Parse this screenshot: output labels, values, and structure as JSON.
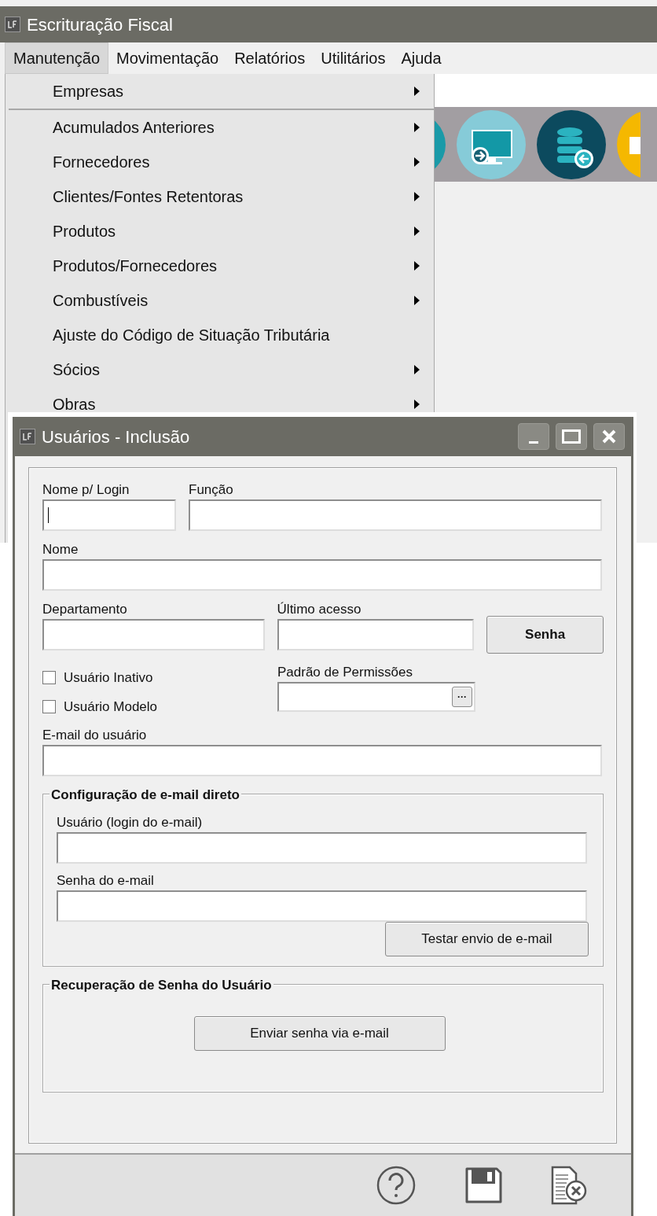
{
  "app": {
    "title": "Escrituração Fiscal"
  },
  "menubar": [
    {
      "label": "Manutenção",
      "selected": true
    },
    {
      "label": "Movimentação",
      "selected": false
    },
    {
      "label": "Relatórios",
      "selected": false
    },
    {
      "label": "Utilitários",
      "selected": false
    },
    {
      "label": "Ajuda",
      "selected": false
    }
  ],
  "menu": [
    {
      "label": "Empresas",
      "has_submenu": true,
      "separator_after": true
    },
    {
      "label": "Acumulados Anteriores",
      "has_submenu": true,
      "separator_after": false
    },
    {
      "label": "Fornecedores",
      "has_submenu": true,
      "separator_after": false
    },
    {
      "label": "Clientes/Fontes Retentoras",
      "has_submenu": true,
      "separator_after": false
    },
    {
      "label": "Produtos",
      "has_submenu": true,
      "separator_after": false
    },
    {
      "label": "Produtos/Fornecedores",
      "has_submenu": true,
      "separator_after": false
    },
    {
      "label": "Combustíveis",
      "has_submenu": true,
      "separator_after": false
    },
    {
      "label": "Ajuste do Código de Situação Tributária",
      "has_submenu": false,
      "separator_after": false
    },
    {
      "label": "Sócios",
      "has_submenu": true,
      "separator_after": false
    },
    {
      "label": "Obras",
      "has_submenu": true,
      "separator_after": false
    }
  ],
  "dialog": {
    "title": "Usuários - Inclusão",
    "login": {
      "label": "Nome p/ Login",
      "focused": true
    },
    "funcao": {
      "label": "Função"
    },
    "nome": {
      "label": "Nome"
    },
    "departamento": {
      "label": "Departamento"
    },
    "ultimo_acesso": {
      "label": "Último acesso"
    },
    "senha_button": "Senha",
    "checkboxes": [
      {
        "label": "Usuário Inativo",
        "checked": false
      },
      {
        "label": "Usuário Modelo",
        "checked": false
      }
    ],
    "permissoes": {
      "label": "Padrão de Permissões",
      "button": "···"
    },
    "email": {
      "label": "E-mail do usuário"
    },
    "email_group": {
      "title": "Configuração de e-mail direto",
      "user_label": "Usuário (login do e-mail)",
      "password_label": "Senha do e-mail",
      "test_button": "Testar envio de e-mail"
    },
    "recovery_group": {
      "title": "Recuperação de Senha do Usuário",
      "send_button": "Enviar senha via e-mail"
    }
  }
}
